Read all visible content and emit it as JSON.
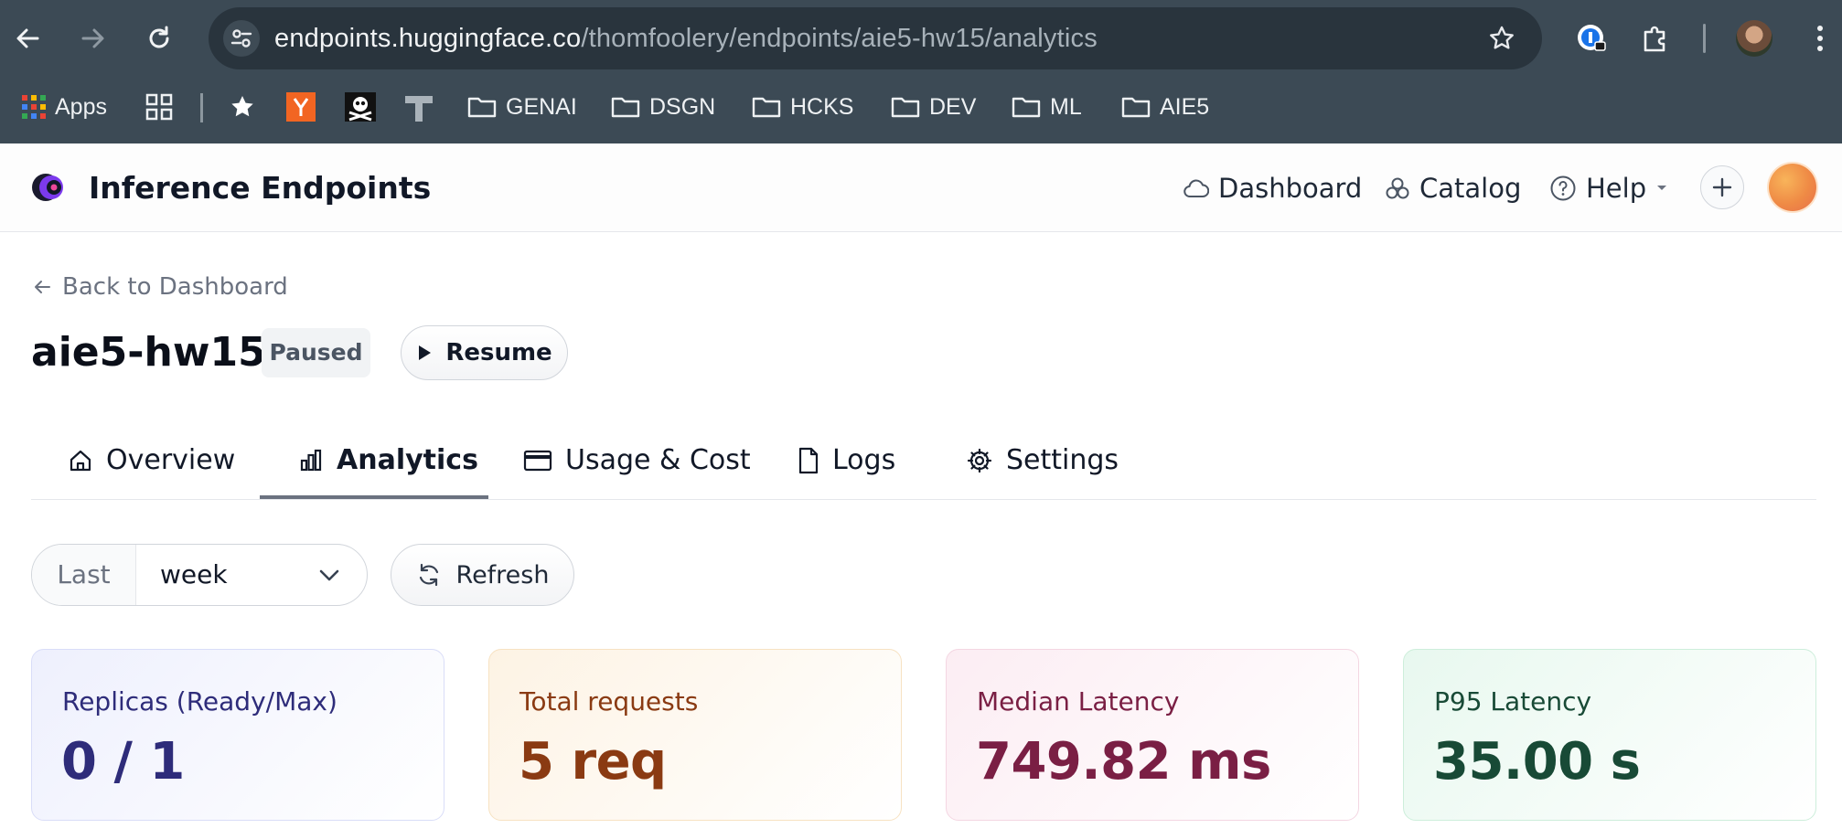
{
  "browser": {
    "url_host": "endpoints.huggingface.co",
    "url_path": "/thomfoolery/endpoints/aie5-hw15/analytics",
    "bookmarks": [
      {
        "label": "Apps"
      },
      {
        "label": "GENAI"
      },
      {
        "label": "DSGN"
      },
      {
        "label": "HCKS"
      },
      {
        "label": "DEV"
      },
      {
        "label": "ML"
      },
      {
        "label": "AIE5"
      }
    ]
  },
  "header": {
    "title": "Inference Endpoints",
    "nav": {
      "dashboard": "Dashboard",
      "catalog": "Catalog",
      "help": "Help"
    }
  },
  "page": {
    "back_label": "Back to Dashboard",
    "endpoint_name": "aie5-hw15",
    "status": "Paused",
    "resume_label": "Resume"
  },
  "tabs": [
    {
      "label": "Overview",
      "active": false
    },
    {
      "label": "Analytics",
      "active": true
    },
    {
      "label": "Usage & Cost",
      "active": false
    },
    {
      "label": "Logs",
      "active": false
    },
    {
      "label": "Settings",
      "active": false
    }
  ],
  "filters": {
    "range_prefix": "Last",
    "range_value": "week",
    "refresh_label": "Refresh"
  },
  "metrics": [
    {
      "label": "Replicas (Ready/Max)",
      "value": "0 / 1",
      "color": "#2e2c7a",
      "bg": "#eef0fd",
      "border": "#d9ddf8"
    },
    {
      "label": "Total requests",
      "value": "5 req",
      "color": "#8a3a12",
      "bg": "#fdf3e4",
      "border": "#f7e2c2"
    },
    {
      "label": "Median Latency",
      "value": "749.82 ms",
      "color": "#7a1f44",
      "bg": "#fcedf3",
      "border": "#f4d6e2"
    },
    {
      "label": "P95 Latency",
      "value": "35.00 s",
      "color": "#184a36",
      "bg": "#e8f8ef",
      "border": "#cdeedb"
    }
  ]
}
